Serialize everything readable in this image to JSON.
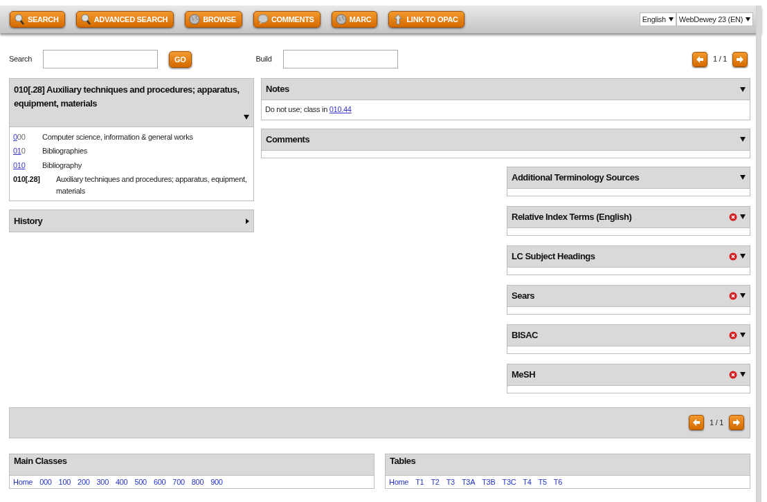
{
  "toolbar": {
    "buttons": [
      {
        "label": "SEARCH",
        "kind": "search"
      },
      {
        "label": "ADVANCED SEARCH",
        "kind": "search"
      },
      {
        "label": "BROWSE",
        "kind": "globe"
      },
      {
        "label": "COMMENTS",
        "kind": "bubble"
      },
      {
        "label": "MARC",
        "kind": "globe"
      },
      {
        "label": "LINK TO OPAC",
        "kind": "arrow"
      }
    ],
    "language": "English",
    "edition": "WebDewey 23 (EN)"
  },
  "search": {
    "label": "Search",
    "go": "GO"
  },
  "build": {
    "label": "Build"
  },
  "pager_top": {
    "text": "1 / 1"
  },
  "record": {
    "title": "010[.28] Auxiliary techniques and procedures; apparatus, equipment, materials",
    "expanded": true,
    "hierarchy": [
      {
        "code_link": "0",
        "code_rest": "00",
        "caption": "Computer science, information & general works",
        "current": false
      },
      {
        "code_link": "01",
        "code_rest": "0",
        "caption": "Bibliographies",
        "current": false
      },
      {
        "code_link": "010",
        "caption": "Bibliography",
        "current": false
      },
      {
        "code_rest": "010[.28]",
        "caption": "Auxiliary techniques and procedures; apparatus, equipment, materials",
        "current": true
      }
    ]
  },
  "history": {
    "title": "History",
    "expanded": false
  },
  "notes": {
    "title": "Notes",
    "expanded": true,
    "text": "Do not use; class in",
    "link": "010.44"
  },
  "comments": {
    "title": "Comments",
    "expanded": true
  },
  "terminology_panels": [
    {
      "title": "Additional Terminology Sources",
      "removable": false,
      "expanded": true
    },
    {
      "title": "Relative Index Terms (English)",
      "removable": true,
      "expanded": true
    },
    {
      "title": "LC Subject Headings",
      "removable": true,
      "expanded": true
    },
    {
      "title": "Sears",
      "removable": true,
      "expanded": true
    },
    {
      "title": "BISAC",
      "removable": true,
      "expanded": true
    },
    {
      "title": "MeSH",
      "removable": true,
      "expanded": true
    }
  ],
  "pager_bottom": {
    "text": "1 / 1"
  },
  "main_classes": {
    "title": "Main Classes",
    "links": [
      "Home",
      "000",
      "100",
      "200",
      "300",
      "400",
      "500",
      "600",
      "700",
      "800",
      "900"
    ]
  },
  "tables": {
    "title": "Tables",
    "links": [
      "Home",
      "T1",
      "T2",
      "T3",
      "T3A",
      "T3B",
      "T3C",
      "T4",
      "T5",
      "T6"
    ]
  }
}
